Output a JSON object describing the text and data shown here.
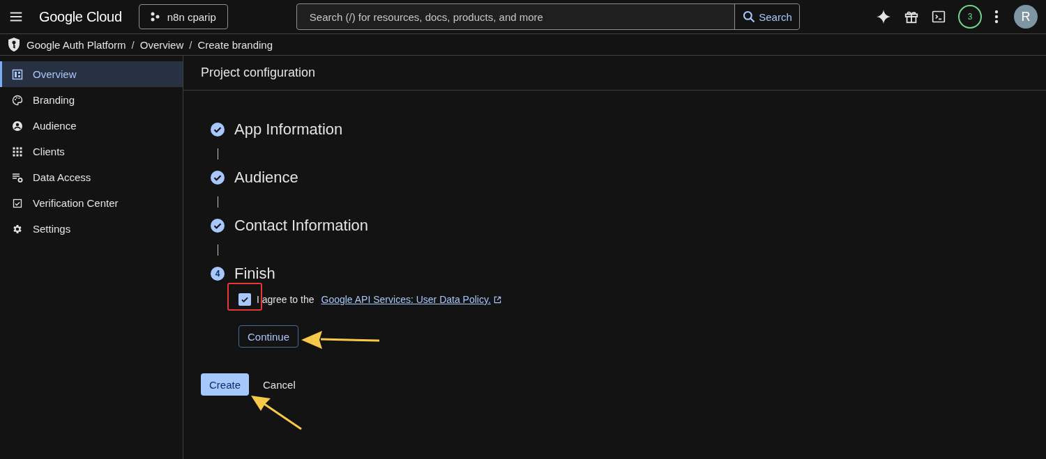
{
  "topbar": {
    "brand": "Google Cloud",
    "project": "n8n cparip",
    "search": {
      "placeholder": "Search (/) for resources, docs, products, and more",
      "button": "Search"
    },
    "notifications": "3",
    "avatar": "R"
  },
  "breadcrumb": {
    "items": [
      "Google Auth Platform",
      "Overview",
      "Create branding"
    ],
    "separator": "/"
  },
  "sidebar": {
    "items": [
      {
        "label": "Overview",
        "selected": true
      },
      {
        "label": "Branding",
        "selected": false
      },
      {
        "label": "Audience",
        "selected": false
      },
      {
        "label": "Clients",
        "selected": false
      },
      {
        "label": "Data Access",
        "selected": false
      },
      {
        "label": "Verification Center",
        "selected": false
      },
      {
        "label": "Settings",
        "selected": false
      }
    ]
  },
  "page_title": "Project configuration",
  "steps": [
    {
      "title": "App Information",
      "kind": "done"
    },
    {
      "title": "Audience",
      "kind": "done"
    },
    {
      "title": "Contact Information",
      "kind": "done"
    },
    {
      "title": "Finish",
      "kind": "current",
      "number": "4"
    }
  ],
  "agreement": {
    "checked": true,
    "text": "I agree to the",
    "link": "Google API Services: User Data Policy."
  },
  "continue_button": "Continue",
  "actions": {
    "primary": "Create",
    "secondary": "Cancel"
  }
}
